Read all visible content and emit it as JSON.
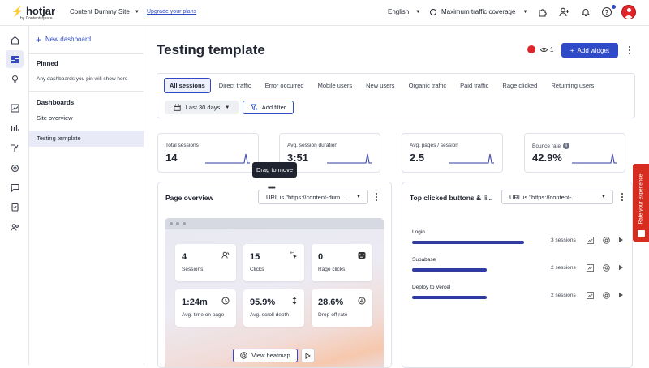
{
  "topbar": {
    "logo_text": "hotjar",
    "logo_sub": "by Contentsquare",
    "site_name": "Content Dummy Site",
    "upgrade_link": "Upgrade your plans",
    "language": "English",
    "coverage": "Maximum traffic coverage"
  },
  "icons": {
    "integrations": "puzzle-icon",
    "invite": "add-user-icon",
    "notifications": "bell-icon",
    "help": "?",
    "accent": "#2f4ac6",
    "brand_red": "#ff3c00"
  },
  "rail": [
    "home-icon",
    "dashboard-icon",
    "lightbulb-icon",
    "trends-icon",
    "chart-icon",
    "funnel-icon",
    "recordings-icon",
    "feedback-icon",
    "survey-icon",
    "interviews-icon"
  ],
  "dash_panel": {
    "new_dashboard": "New dashboard",
    "pinned_heading": "Pinned",
    "pinned_text": "Any dashboards you pin will show here",
    "dashboards_heading": "Dashboards",
    "items": [
      "Site overview",
      "Testing template"
    ]
  },
  "header": {
    "title": "Testing template",
    "viewer_count": "1",
    "add_widget": "Add widget"
  },
  "segments": [
    "All sessions",
    "Direct traffic",
    "Error occurred",
    "Mobile users",
    "New users",
    "Organic traffic",
    "Paid traffic",
    "Rage clicked",
    "Returning users"
  ],
  "filters": {
    "date_range": "Last 30 days",
    "add_filter": "Add filter"
  },
  "kpis": [
    {
      "label": "Total sessions",
      "value": "14"
    },
    {
      "label": "Avg. session duration",
      "value": "3:51"
    },
    {
      "label": "Avg. pages / session",
      "value": "2.5"
    },
    {
      "label": "Bounce rate",
      "value": "42.9%"
    }
  ],
  "tooltip": "Drag to move",
  "page_overview": {
    "title": "Page overview",
    "url_filter": "URL is \"https://content-dum...",
    "stats": [
      {
        "value": "4",
        "label": "Sessions"
      },
      {
        "value": "15",
        "label": "Clicks"
      },
      {
        "value": "0",
        "label": "Rage clicks"
      },
      {
        "value": "1:24m",
        "label": "Avg. time on page"
      },
      {
        "value": "95.9%",
        "label": "Avg. scroll depth"
      },
      {
        "value": "28.6%",
        "label": "Drop-off rate"
      }
    ],
    "view_heatmap": "View heatmap"
  },
  "top_clicked": {
    "title": "Top clicked buttons & li...",
    "url_filter": "URL is \"https://content-...",
    "rows": [
      {
        "label": "Login",
        "count": "3 sessions",
        "fraction": 1.0
      },
      {
        "label": "Supabase",
        "count": "2 sessions",
        "fraction": 0.667
      },
      {
        "label": "Deploy to Vercel",
        "count": "2 sessions",
        "fraction": 0.667
      }
    ]
  },
  "feedback_tab": "Rate your experience"
}
